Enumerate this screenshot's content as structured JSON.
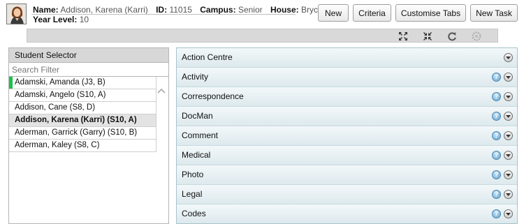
{
  "student": {
    "name_label": "Name:",
    "name": "Addison, Karena (Karri)",
    "id_label": "ID:",
    "id": "11015",
    "campus_label": "Campus:",
    "campus": "Senior",
    "house_label": "House:",
    "house": "Bryce",
    "year_label": "Year Level:",
    "year": "10"
  },
  "buttons": {
    "new": "New",
    "criteria": "Criteria",
    "customise_tabs": "Customise Tabs",
    "new_task": "New Task"
  },
  "toolbar_icons": [
    "expand-icon",
    "collapse-icon",
    "refresh-icon",
    "settings-icon"
  ],
  "selector": {
    "title": "Student Selector",
    "search_placeholder": "Search Filter",
    "students": [
      "Adamski, Amanda (J3, B)",
      "Adamski, Angelo (S10, A)",
      "Addison, Cane (S8, D)",
      "Addison, Karena (Karri) (S10, A)",
      "Aderman, Garrick (Garry) (S10, B)",
      "Aderman, Kaley (S8, C)"
    ]
  },
  "panels": [
    "Action Centre",
    "Activity",
    "Correspondence",
    "DocMan",
    "Comment",
    "Medical",
    "Photo",
    "Legal",
    "Codes"
  ],
  "colors": {
    "selected_marker": "#19c24a",
    "panel_bg": "#e6f0f3"
  }
}
